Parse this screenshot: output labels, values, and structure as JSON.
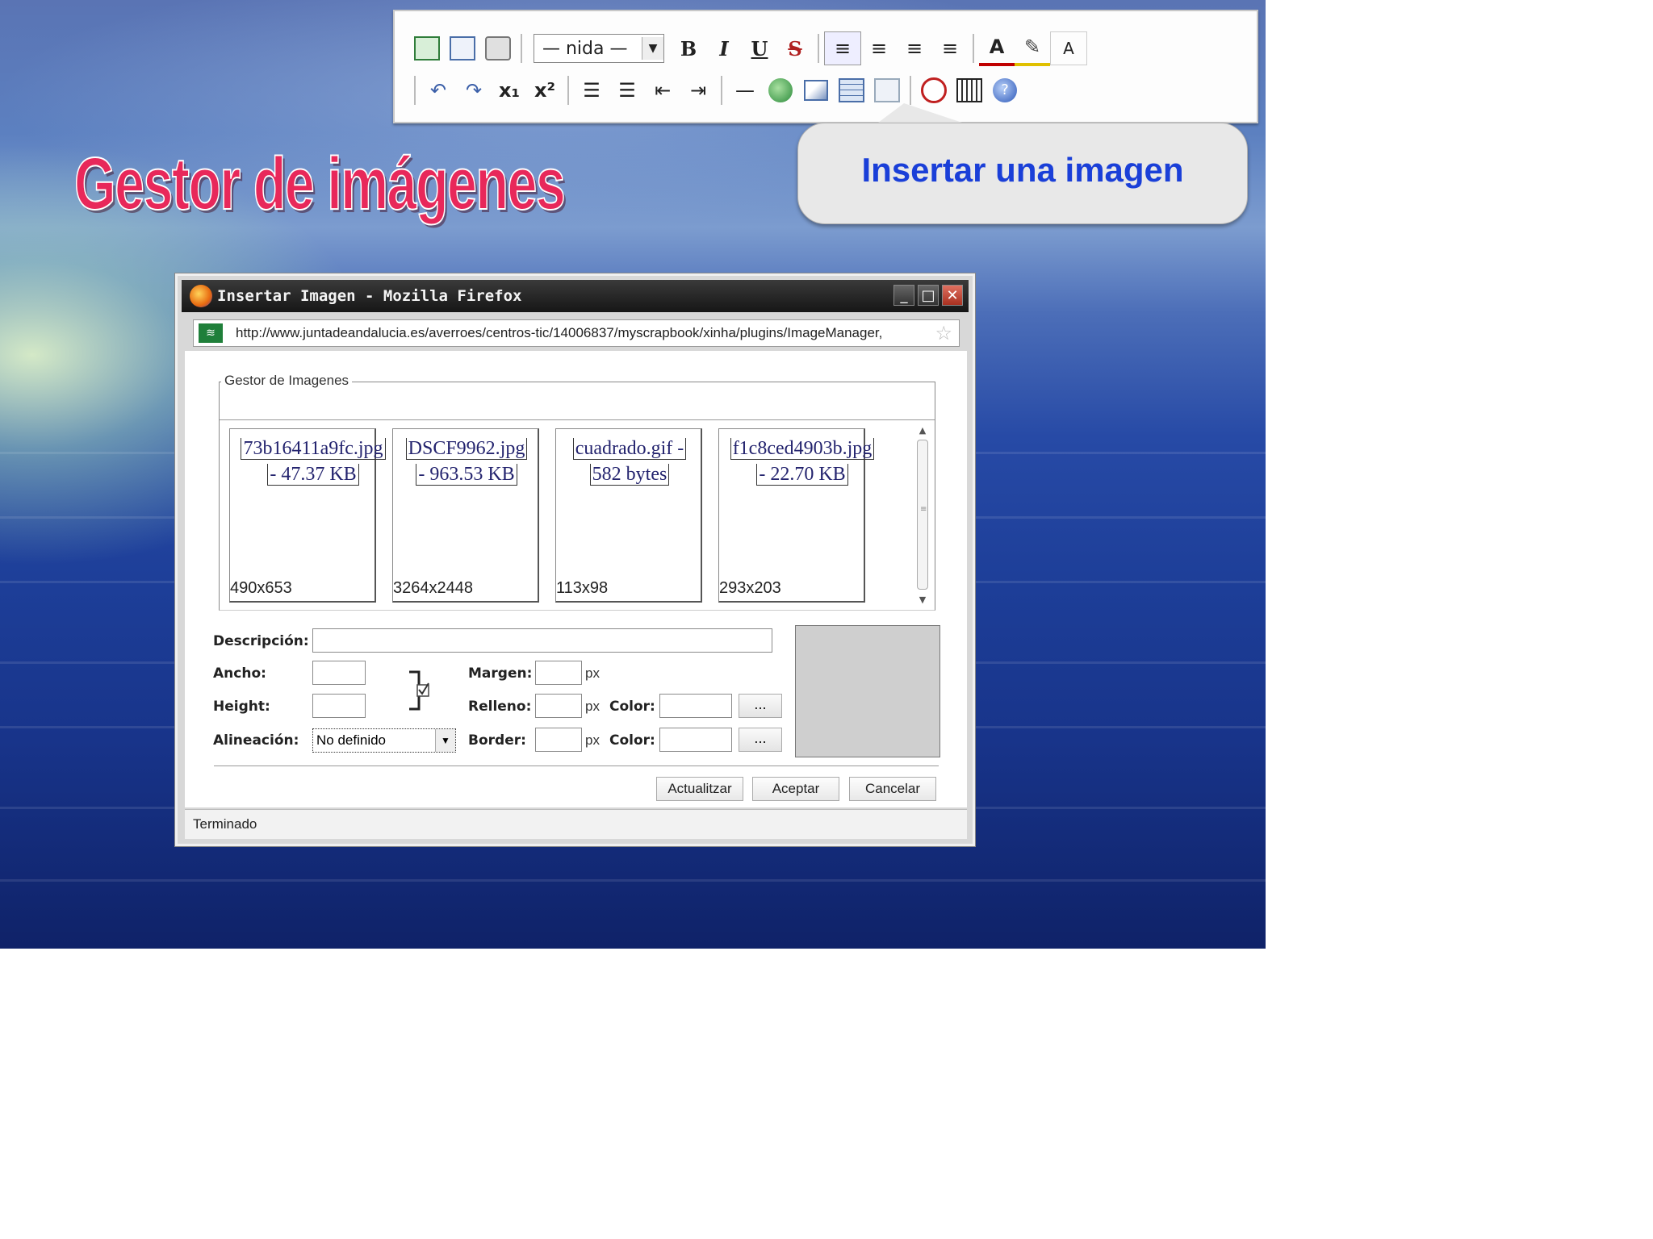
{
  "slide": {
    "title": "Gestor de imágenes",
    "callout": "Insertar una imagen"
  },
  "toolbar": {
    "font_select": "— nida —",
    "row1_icons": [
      "insert-image-icon",
      "html-icon",
      "print-icon",
      "bold-icon",
      "italic-icon",
      "underline-icon",
      "strikethrough-icon",
      "align-left-icon",
      "align-center-icon",
      "align-right-icon",
      "justify-icon",
      "font-color-icon",
      "highlight-color-icon",
      "text-direction-icon"
    ],
    "row2_icons": [
      "undo-icon",
      "redo-icon",
      "subscript-icon",
      "superscript-icon",
      "ordered-list-icon",
      "unordered-list-icon",
      "outdent-icon",
      "indent-icon",
      "horizontal-rule-icon",
      "insert-link-icon",
      "insert-image-icon",
      "insert-table-icon",
      "table-props-icon",
      "source-icon",
      "fullscreen-icon",
      "help-icon"
    ]
  },
  "window": {
    "title": "Insertar Imagen - Mozilla Firefox",
    "url": "http://www.juntadeandalucia.es/averroes/centros-tic/14006837/myscrapbook/xinha/plugins/ImageManager,"
  },
  "manager": {
    "legend": "Gestor de Imagenes",
    "images": [
      {
        "name_line1": "73b16411a9fc.jpg",
        "name_line2": "- 47.37 KB",
        "dims": "490x653"
      },
      {
        "name_line1": "DSCF9962.jpg",
        "name_line2": "- 963.53 KB",
        "dims": "3264x2448"
      },
      {
        "name_line1": "cuadrado.gif -",
        "name_line2": "582 bytes",
        "dims": "113x98"
      },
      {
        "name_line1": "f1c8ced4903b.jpg",
        "name_line2": "- 22.70 KB",
        "dims": "293x203"
      }
    ]
  },
  "form": {
    "descripcion_label": "Descripción:",
    "ancho_label": "Ancho:",
    "height_label": "Height:",
    "alineacion_label": "Alineación:",
    "alineacion_value": "No definido",
    "margen_label": "Margen:",
    "relleno_label": "Relleno:",
    "border_label": "Border:",
    "color_label": "Color:",
    "px": "px",
    "dots": "...",
    "buttons": {
      "actualizar": "Actualitzar",
      "aceptar": "Aceptar",
      "cancelar": "Cancelar"
    }
  },
  "status": "Terminado"
}
